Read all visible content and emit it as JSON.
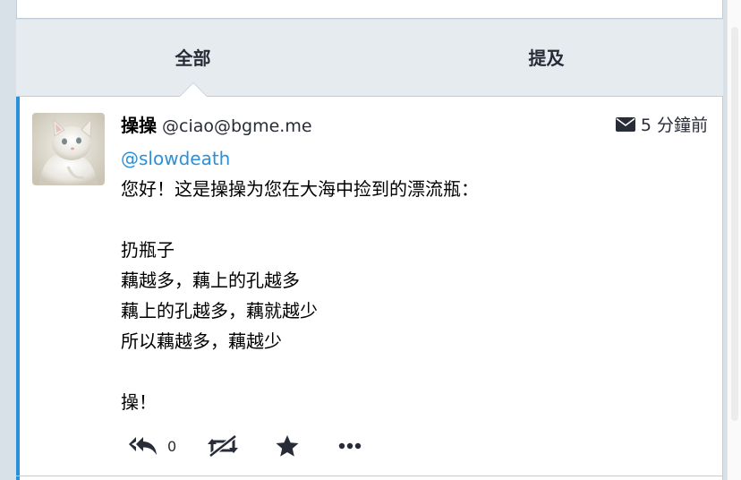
{
  "tabs": {
    "all_label": "全部",
    "mention_label": "提及"
  },
  "status": {
    "display_name": "操操",
    "acct": "@ciao@bgme.me",
    "timestamp": "5 分鐘前",
    "visibility_icon": "envelope-icon",
    "mention": "@slowdeath",
    "lines": [
      "您好！这是操操为您在大海中捡到的漂流瓶：",
      "",
      "扔瓶子",
      "藕越多，藕上的孔越多",
      "藕上的孔越多，藕就越少",
      "所以藕越多，藕越少",
      "",
      "操！"
    ],
    "reply_count": "0"
  },
  "colors": {
    "accent": "#2b90d9",
    "tab_bg": "#e6ebf0",
    "border": "#c0cdd9",
    "page_bg": "#d9e1e8"
  }
}
